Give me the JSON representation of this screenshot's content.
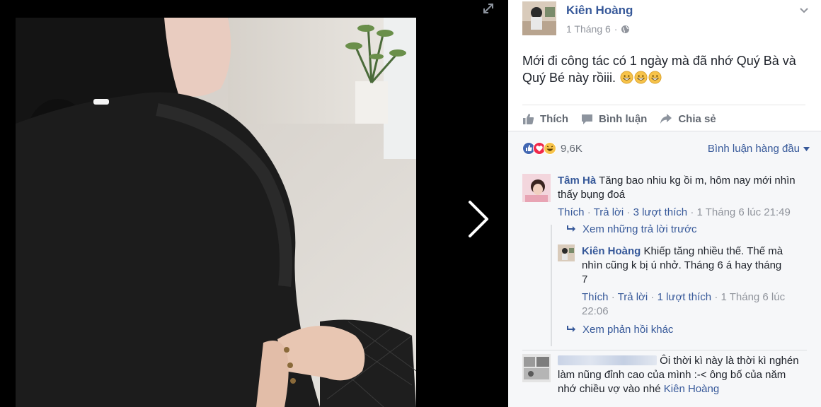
{
  "post": {
    "author": "Kiên Hoàng",
    "date": "1 Tháng 6",
    "dot": "·",
    "text_line1": "Mới đi công tác có 1 ngày mà đã nhớ Quý Bà và",
    "text_line2": "Quý Bé này rồiii.",
    "emojis": [
      "grinning-emoji",
      "grinning-emoji",
      "grinning-emoji"
    ]
  },
  "actions": {
    "like": "Thích",
    "comment": "Bình luận",
    "share": "Chia sẻ"
  },
  "stats": {
    "count": "9,6K",
    "sort": "Bình luận hàng đầu"
  },
  "comments": [
    {
      "name": "Tâm Hà",
      "text_line1": "Tăng bao nhiu kg ồi m, hôm nay mới nhìn",
      "text_line2": "thấy bụng đoá",
      "like": "Thích",
      "reply": "Trả lời",
      "likes": "3 lượt thích",
      "time": "1 Tháng 6 lúc 21:49",
      "sep": "·"
    }
  ],
  "view_previous": "Xem những trả lời trước",
  "reply": {
    "name": "Kiên Hoàng",
    "text_line1": "Khiếp tăng nhiều thế. Thế mà",
    "text_line2": "nhìn cũng k bị ú nhở. Tháng 6 á hay tháng",
    "text_line3": "7",
    "like": "Thích",
    "reply": "Trả lời",
    "likes": "1 lượt thích",
    "time_line1": "1 Tháng 6 lúc",
    "time_line2": "22:06",
    "sep": "·"
  },
  "view_more": "Xem phản hồi khác",
  "comment2": {
    "text_line1": "Ôi thời kì này là thời kì nghén",
    "text_line2": "làm nũng đỉnh cao của mình :-< ông bố của năm",
    "text_line3": "nhớ chiều vợ vào nhé",
    "mention": "Kiên Hoàng"
  },
  "colors": {
    "link": "#365899",
    "meta": "#90949c",
    "like_blue": "#4267b2",
    "love_red": "#f0284a",
    "haha_yellow": "#f7c34a"
  }
}
